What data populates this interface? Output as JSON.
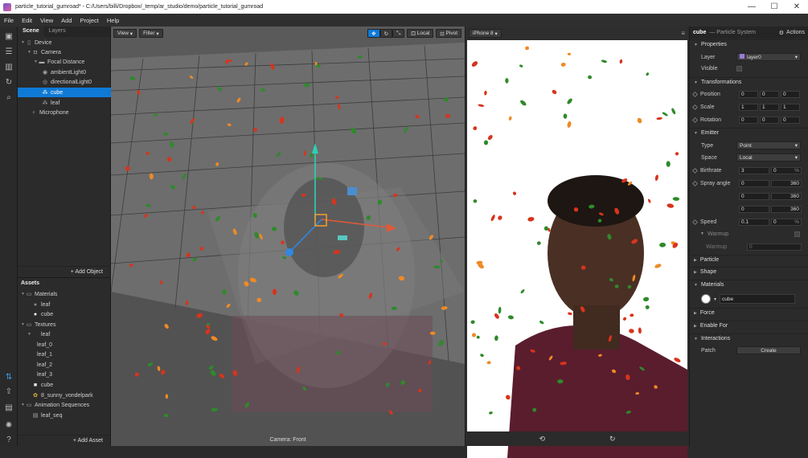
{
  "window": {
    "title": "particle_tutorial_gumroad* - C:/Users/billi/Dropbox/_temp/ar_studio/demo/particle_tutorial_gumroad",
    "min": "—",
    "max": "☐",
    "close": "✕"
  },
  "menu": [
    "File",
    "Edit",
    "View",
    "Add",
    "Project",
    "Help"
  ],
  "scene_panel": {
    "tabs": [
      "Scene",
      "Layers"
    ],
    "items": [
      {
        "label": "Device",
        "icon": "▯"
      },
      {
        "label": "Camera",
        "icon": "◘"
      },
      {
        "label": "Focal Distance",
        "icon": "▬"
      },
      {
        "label": "ambientLight0",
        "icon": "◉"
      },
      {
        "label": "directionalLight0",
        "icon": "◎"
      },
      {
        "label": "cube",
        "icon": "⁂"
      },
      {
        "label": "leaf",
        "icon": "⁂"
      },
      {
        "label": "Microphone",
        "icon": "♀"
      }
    ],
    "add_label": "+ Add Object"
  },
  "assets_panel": {
    "title": "Assets",
    "items": [
      {
        "label": "Materials",
        "icon": "▭"
      },
      {
        "label": "leaf",
        "icon": "●"
      },
      {
        "label": "cube",
        "icon": "●"
      },
      {
        "label": "Textures",
        "icon": "▭"
      },
      {
        "label": "leaf",
        "icon": ""
      },
      {
        "label": "leaf_0",
        "icon": ""
      },
      {
        "label": "leaf_1",
        "icon": ""
      },
      {
        "label": "leaf_2",
        "icon": ""
      },
      {
        "label": "leaf_3",
        "icon": ""
      },
      {
        "label": "cube",
        "icon": "■"
      },
      {
        "label": "8_sunny_vondelpark",
        "icon": "✿"
      },
      {
        "label": "Animation Sequences",
        "icon": "▭"
      },
      {
        "label": "leaf_seq",
        "icon": "▤"
      }
    ],
    "add_label": "+ Add Asset"
  },
  "viewport": {
    "view_label": "View",
    "filter_label": "Filter",
    "local_label": "Local",
    "pivot_label": "Pivot",
    "camera_label": "Camera: Front"
  },
  "preview": {
    "device": "iPhone 8"
  },
  "inspector": {
    "object": "cube",
    "type": "— Particle System",
    "actions": "Actions",
    "sections": {
      "properties": "Properties",
      "transformations": "Transformations",
      "emitter": "Emitter",
      "particle": "Particle",
      "shape": "Shape",
      "materials": "Materials",
      "force": "Force",
      "enable_for": "Enable For",
      "interactions": "Interactions"
    },
    "layer": {
      "label": "Layer",
      "value": "layer0"
    },
    "visible": {
      "label": "Visible"
    },
    "position": {
      "label": "Position",
      "x": "0",
      "y": "0",
      "z": "0"
    },
    "scale": {
      "label": "Scale",
      "x": "1",
      "y": "1",
      "z": "1"
    },
    "rotation": {
      "label": "Rotation",
      "x": "0",
      "y": "0",
      "z": "0"
    },
    "type_row": {
      "label": "Type",
      "value": "Point"
    },
    "space_row": {
      "label": "Space",
      "value": "Local"
    },
    "birthrate": {
      "label": "Birthrate",
      "value": "3",
      "var": "0",
      "unit": "%"
    },
    "spray_angle": {
      "label": "Spray angle",
      "rows": [
        [
          "0",
          "360"
        ],
        [
          "0",
          "360"
        ],
        [
          "0",
          "360"
        ]
      ]
    },
    "speed": {
      "label": "Speed",
      "value": "0.1",
      "var": "0",
      "unit": "%"
    },
    "warmup_group": "Warmup",
    "warmup_row": {
      "label": "Warmup",
      "value": "0"
    },
    "material_name": "cube",
    "patch": {
      "label": "Patch",
      "button": "Create"
    }
  },
  "colors": {
    "accent": "#0f7ad6",
    "leaf_red": "#d7341c",
    "leaf_green": "#2e8a2a",
    "leaf_orange": "#f08a24"
  }
}
